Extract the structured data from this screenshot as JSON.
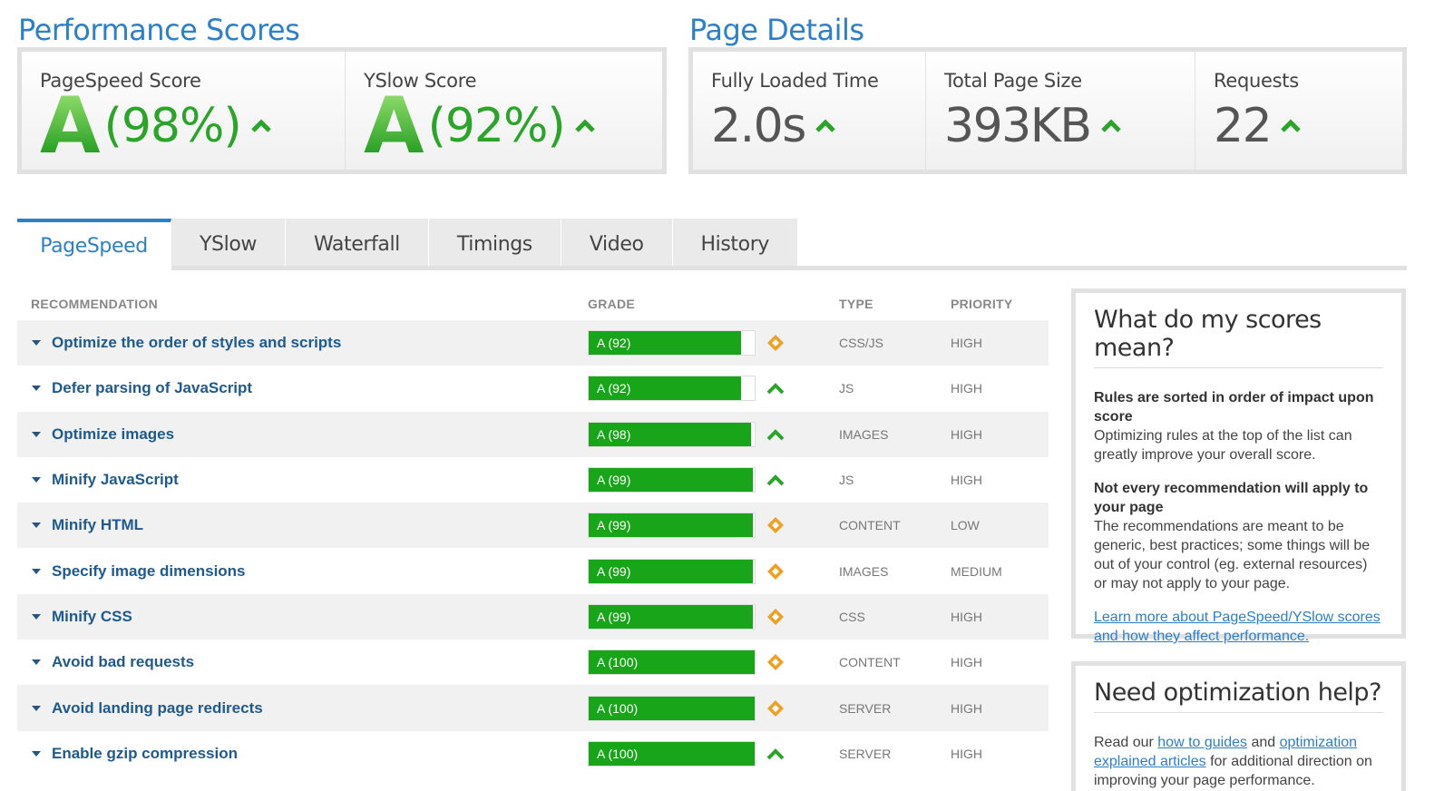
{
  "performance": {
    "title": "Performance Scores",
    "pagespeed": {
      "label": "PageSpeed Score",
      "grade": "A",
      "percent": "(98%)"
    },
    "yslow": {
      "label": "YSlow Score",
      "grade": "A",
      "percent": "(92%)"
    }
  },
  "details": {
    "title": "Page Details",
    "fully_loaded": {
      "label": "Fully Loaded Time",
      "value": "2.0s"
    },
    "page_size": {
      "label": "Total Page Size",
      "value": "393KB"
    },
    "requests": {
      "label": "Requests",
      "value": "22"
    }
  },
  "tabs": [
    {
      "label": "PageSpeed",
      "active": true
    },
    {
      "label": "YSlow"
    },
    {
      "label": "Waterfall"
    },
    {
      "label": "Timings"
    },
    {
      "label": "Video"
    },
    {
      "label": "History"
    }
  ],
  "table": {
    "headers": {
      "recommendation": "RECOMMENDATION",
      "grade": "GRADE",
      "type": "TYPE",
      "priority": "PRIORITY"
    },
    "rows": [
      {
        "name": "Optimize the order of styles and scripts",
        "grade": "A (92)",
        "score": 92,
        "status": "diamond",
        "type": "CSS/JS",
        "priority": "HIGH"
      },
      {
        "name": "Defer parsing of JavaScript",
        "grade": "A (92)",
        "score": 92,
        "status": "up",
        "type": "JS",
        "priority": "HIGH"
      },
      {
        "name": "Optimize images",
        "grade": "A (98)",
        "score": 98,
        "status": "up",
        "type": "IMAGES",
        "priority": "HIGH"
      },
      {
        "name": "Minify JavaScript",
        "grade": "A (99)",
        "score": 99,
        "status": "up",
        "type": "JS",
        "priority": "HIGH"
      },
      {
        "name": "Minify HTML",
        "grade": "A (99)",
        "score": 99,
        "status": "diamond",
        "type": "CONTENT",
        "priority": "LOW"
      },
      {
        "name": "Specify image dimensions",
        "grade": "A (99)",
        "score": 99,
        "status": "diamond",
        "type": "IMAGES",
        "priority": "MEDIUM"
      },
      {
        "name": "Minify CSS",
        "grade": "A (99)",
        "score": 99,
        "status": "diamond",
        "type": "CSS",
        "priority": "HIGH"
      },
      {
        "name": "Avoid bad requests",
        "grade": "A (100)",
        "score": 100,
        "status": "diamond",
        "type": "CONTENT",
        "priority": "HIGH"
      },
      {
        "name": "Avoid landing page redirects",
        "grade": "A (100)",
        "score": 100,
        "status": "diamond",
        "type": "SERVER",
        "priority": "HIGH"
      },
      {
        "name": "Enable gzip compression",
        "grade": "A (100)",
        "score": 100,
        "status": "up",
        "type": "SERVER",
        "priority": "HIGH"
      }
    ]
  },
  "scores_help": {
    "title": "What do my scores mean?",
    "p1_bold": "Rules are sorted in order of impact upon score",
    "p1_text": "Optimizing rules at the top of the list can greatly improve your overall score.",
    "p2_bold": "Not every recommendation will apply to your page",
    "p2_text": "The recommendations are meant to be generic, best practices; some things will be out of your control (eg. external resources) or may not apply to your page.",
    "link": "Learn more about PageSpeed/YSlow scores and how they affect performance."
  },
  "optimization_help": {
    "title": "Need optimization help?",
    "text_read": "Read our",
    "link_guides": "how to guides",
    "text_and": "and",
    "link_articles": "optimization explained articles",
    "text_rest": "for additional direction on improving your page performance."
  },
  "colors": {
    "accent": "#2c7fc9",
    "grade_green": "#19a519",
    "diamond_orange": "#f0a020",
    "arrow_green": "#2aa52a"
  }
}
